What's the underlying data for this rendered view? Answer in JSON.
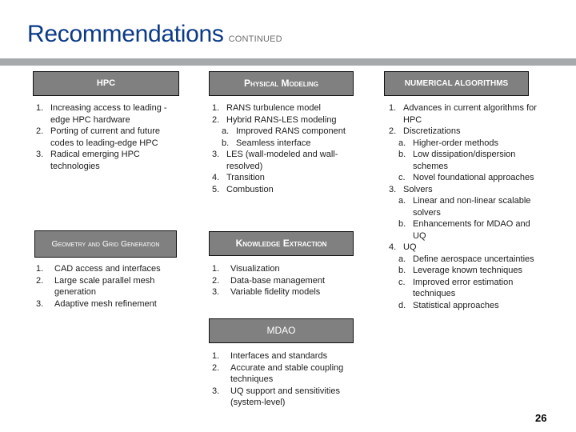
{
  "header": {
    "title": "Recommendations",
    "subtitle": "CONTINUED"
  },
  "sections": {
    "hpc": {
      "title": "HPC",
      "items": [
        {
          "num": "1.",
          "text": "Increasing access to leading -edge HPC hardware"
        },
        {
          "num": "2.",
          "text": "Porting of current and future codes to leading-edge HPC"
        },
        {
          "num": "3.",
          "text": "Radical emerging HPC technologies"
        }
      ]
    },
    "physical_modeling": {
      "title": "Physical Modeling",
      "items": [
        {
          "num": "1.",
          "text": "RANS turbulence model"
        },
        {
          "num": "2.",
          "text": "Hybrid RANS-LES modeling"
        },
        {
          "num": "a.",
          "text": "Improved RANS component",
          "sub": true
        },
        {
          "num": "b.",
          "text": "Seamless interface",
          "sub": true
        },
        {
          "num": "3.",
          "text": "LES (wall-modeled and wall-resolved)"
        },
        {
          "num": "4.",
          "text": "Transition"
        },
        {
          "num": "5.",
          "text": "Combustion"
        }
      ]
    },
    "numerical_algorithms": {
      "title": "NUMERICAL ALGORITHMS",
      "items": [
        {
          "num": "1.",
          "text": "Advances in current algorithms for HPC"
        },
        {
          "num": "2.",
          "text": "Discretizations"
        },
        {
          "num": "a.",
          "text": "Higher-order methods",
          "sub": true
        },
        {
          "num": "b.",
          "text": "Low dissipation/dispersion schemes",
          "sub": true
        },
        {
          "num": "c.",
          "text": "Novel foundational approaches",
          "sub": true
        },
        {
          "num": "3.",
          "text": "Solvers"
        },
        {
          "num": "a.",
          "text": "Linear and non-linear scalable solvers",
          "sub": true
        },
        {
          "num": "b.",
          "text": "Enhancements for MDAO and UQ",
          "sub": true
        },
        {
          "num": "4.",
          "text": "UQ"
        },
        {
          "num": "a.",
          "text": "Define aerospace uncertainties",
          "sub": true
        },
        {
          "num": "b.",
          "text": "Leverage known techniques",
          "sub": true
        },
        {
          "num": "c.",
          "text": "Improved error estimation techniques",
          "sub": true
        },
        {
          "num": "d.",
          "text": "Statistical approaches",
          "sub": true
        }
      ]
    },
    "geometry_grid": {
      "title": "Geometry and Grid Generation",
      "items": [
        {
          "num": "1.",
          "text": "CAD access and interfaces"
        },
        {
          "num": "2.",
          "text": "Large scale parallel mesh generation"
        },
        {
          "num": "3.",
          "text": "Adaptive mesh refinement"
        }
      ]
    },
    "knowledge_extraction": {
      "title": "Knowledge Extraction",
      "items": [
        {
          "num": "1.",
          "text": "Visualization"
        },
        {
          "num": "2.",
          "text": "Data-base management"
        },
        {
          "num": "3.",
          "text": "Variable fidelity models"
        }
      ]
    },
    "mdao": {
      "title": "MDAO",
      "items": [
        {
          "num": "1.",
          "text": "Interfaces and standards"
        },
        {
          "num": "2.",
          "text": "Accurate and stable coupling techniques"
        },
        {
          "num": "3.",
          "text": "UQ support and sensitivities (system-level)"
        }
      ]
    }
  },
  "footer": {
    "page_number": "26"
  }
}
